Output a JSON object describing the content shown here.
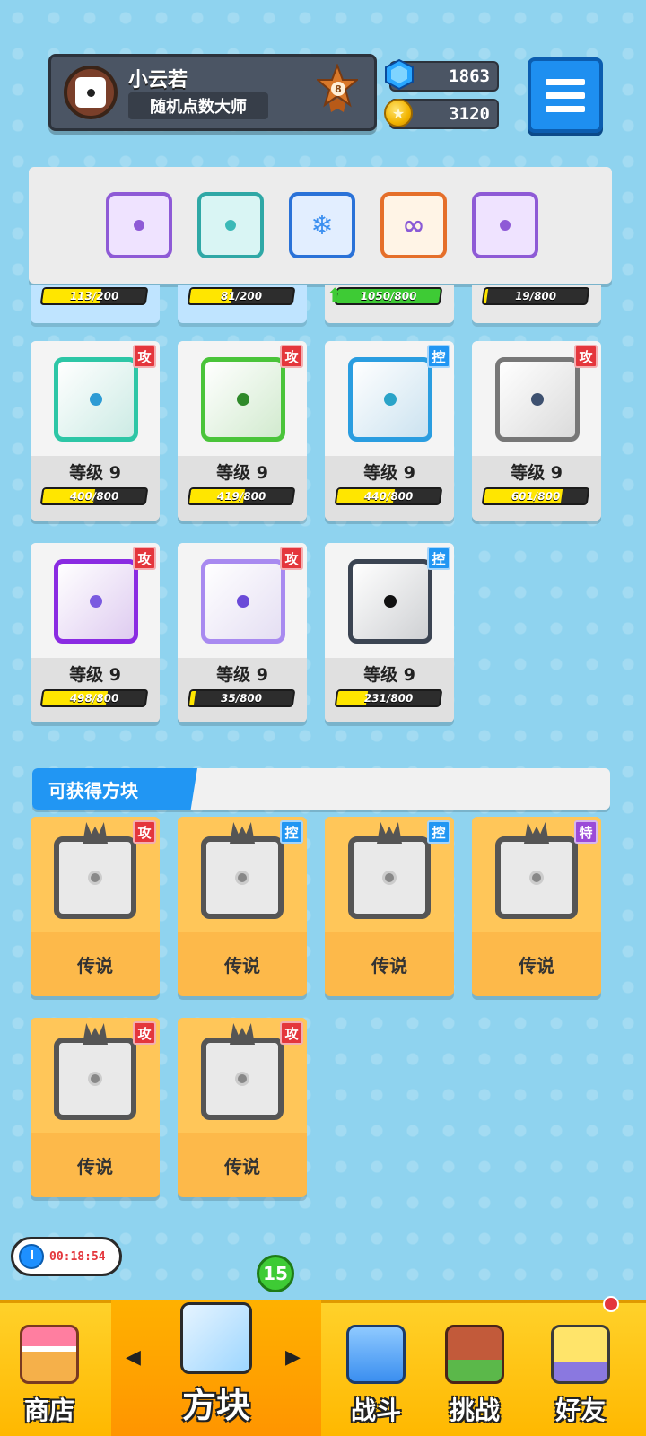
{
  "profile": {
    "name": "小云若",
    "title": "随机点数大师",
    "rank_badge": "8"
  },
  "currency": {
    "gems": "1863",
    "coins": "3120"
  },
  "deck": [
    {
      "icon": "purple-magic-dice-icon",
      "color": "#8e5ad6"
    },
    {
      "icon": "teal-dice-icon",
      "color": "#3bb9b7"
    },
    {
      "icon": "ice-dice-icon",
      "color": "#4b8ff0"
    },
    {
      "icon": "infinity-dice-icon",
      "color": "#ef8a3a"
    },
    {
      "icon": "purple-swirl-dice-icon",
      "color": "#8e5ad6"
    }
  ],
  "partial_row": [
    {
      "progress_text": "113/200",
      "progress": 0.565
    },
    {
      "progress_text": "81/200",
      "progress": 0.405
    },
    {
      "progress_text": "1050/800",
      "progress": 1.0
    },
    {
      "progress_text": "19/800",
      "progress": 0.024
    }
  ],
  "owned_dice": [
    {
      "badge": "攻",
      "badge_type": "atk",
      "level": "等级 9",
      "progress_text": "400/800",
      "progress": 0.5,
      "color": "#2dc6a6",
      "pip": "#2d9bd4",
      "icon": "wind-dice-icon"
    },
    {
      "badge": "攻",
      "badge_type": "atk",
      "level": "等级 9",
      "progress_text": "419/800",
      "progress": 0.524,
      "color": "#4ac43a",
      "pip": "#2f8a2a",
      "icon": "poison-dice-icon"
    },
    {
      "badge": "控",
      "badge_type": "ctl",
      "level": "等级 9",
      "progress_text": "440/800",
      "progress": 0.55,
      "color": "#2a9de0",
      "pip": "#2aa3c8",
      "icon": "ice-dice-icon"
    },
    {
      "badge": "攻",
      "badge_type": "atk",
      "level": "等级 9",
      "progress_text": "601/800",
      "progress": 0.751,
      "color": "#777777",
      "pip": "#3e5170",
      "icon": "gear-dice-icon"
    },
    {
      "badge": "攻",
      "badge_type": "atk",
      "level": "等级 9",
      "progress_text": "498/800",
      "progress": 0.6225,
      "color": "#8a2be2",
      "pip": "#7a5ae0",
      "icon": "arrow-dice-icon"
    },
    {
      "badge": "攻",
      "badge_type": "atk",
      "level": "等级 9",
      "progress_text": "35/800",
      "progress": 0.044,
      "color": "#a88af0",
      "pip": "#6a4ad8",
      "icon": "mystery-dice-icon"
    },
    {
      "badge": "控",
      "badge_type": "ctl",
      "level": "等级 9",
      "progress_text": "231/800",
      "progress": 0.289,
      "color": "#3b4452",
      "pip": "#111111",
      "icon": "lock-dice-icon"
    }
  ],
  "available_section": {
    "title": "可获得方块"
  },
  "legendary_dice": [
    {
      "badge": "攻",
      "badge_type": "atk",
      "rarity": "传说",
      "icon": "legendary-gear-dice-icon"
    },
    {
      "badge": "控",
      "badge_type": "ctl",
      "rarity": "传说",
      "icon": "legendary-storm-dice-icon"
    },
    {
      "badge": "控",
      "badge_type": "ctl",
      "rarity": "传说",
      "icon": "legendary-shield-dice-icon"
    },
    {
      "badge": "特",
      "badge_type": "spc",
      "rarity": "传说",
      "icon": "legendary-sword-dice-icon"
    },
    {
      "badge": "攻",
      "badge_type": "atk",
      "rarity": "传说",
      "icon": "legendary-swirl-dice-icon"
    },
    {
      "badge": "攻",
      "badge_type": "atk",
      "rarity": "传说",
      "icon": "legendary-blackhole-dice-icon"
    }
  ],
  "timer": "00:18:54",
  "nav": {
    "shop": "商店",
    "blocks": "方块",
    "battle": "战斗",
    "challenge": "挑战",
    "friends": "好友",
    "blocks_count": "15"
  }
}
